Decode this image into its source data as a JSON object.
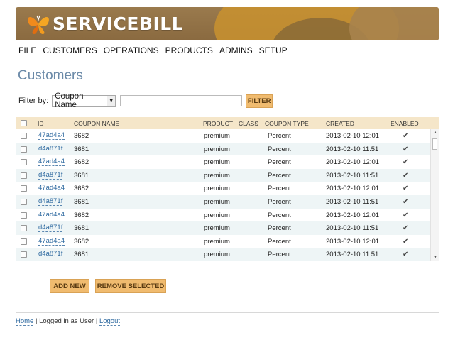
{
  "brand": {
    "name": "SERVICEBILL"
  },
  "menu": [
    "FILE",
    "CUSTOMERS",
    "OPERATIONS",
    "PRODUCTS",
    "ADMINS",
    "SETUP"
  ],
  "page": {
    "title": "Customers"
  },
  "filter": {
    "label": "Filter by:",
    "selected": "Coupon Name",
    "input_value": "",
    "button": "FILTER"
  },
  "grid": {
    "columns": [
      "ID",
      "COUPON NAME",
      "PRODUCT",
      "CLASS",
      "COUPON TYPE",
      "CREATED",
      "ENABLED"
    ],
    "rows": [
      {
        "id": "47ad4a4",
        "coupon_name": "3682",
        "product": "premium",
        "class": "",
        "coupon_type": "Percent",
        "created": "2013-02-10 12:01",
        "enabled": "✔"
      },
      {
        "id": "d4a871f",
        "coupon_name": "3681",
        "product": "premium",
        "class": "",
        "coupon_type": "Percent",
        "created": "2013-02-10 11:51",
        "enabled": "✔"
      },
      {
        "id": "47ad4a4",
        "coupon_name": "3682",
        "product": "premium",
        "class": "",
        "coupon_type": "Percent",
        "created": "2013-02-10 12:01",
        "enabled": "✔"
      },
      {
        "id": "d4a871f",
        "coupon_name": "3681",
        "product": "premium",
        "class": "",
        "coupon_type": "Percent",
        "created": "2013-02-10 11:51",
        "enabled": "✔"
      },
      {
        "id": "47ad4a4",
        "coupon_name": "3682",
        "product": "premium",
        "class": "",
        "coupon_type": "Percent",
        "created": "2013-02-10 12:01",
        "enabled": "✔"
      },
      {
        "id": "d4a871f",
        "coupon_name": "3681",
        "product": "premium",
        "class": "",
        "coupon_type": "Percent",
        "created": "2013-02-10 11:51",
        "enabled": "✔"
      },
      {
        "id": "47ad4a4",
        "coupon_name": "3682",
        "product": "premium",
        "class": "",
        "coupon_type": "Percent",
        "created": "2013-02-10 12:01",
        "enabled": "✔"
      },
      {
        "id": "d4a871f",
        "coupon_name": "3681",
        "product": "premium",
        "class": "",
        "coupon_type": "Percent",
        "created": "2013-02-10 11:51",
        "enabled": "✔"
      },
      {
        "id": "47ad4a4",
        "coupon_name": "3682",
        "product": "premium",
        "class": "",
        "coupon_type": "Percent",
        "created": "2013-02-10 12:01",
        "enabled": "✔"
      },
      {
        "id": "d4a871f",
        "coupon_name": "3681",
        "product": "premium",
        "class": "",
        "coupon_type": "Percent",
        "created": "2013-02-10 11:51",
        "enabled": "✔"
      }
    ]
  },
  "actions": {
    "add": "ADD NEW",
    "remove": "REMOVE SELECTED"
  },
  "footer": {
    "home": "Home",
    "separator": "|",
    "logged_in": "Logged in as User",
    "logout": "Logout"
  },
  "colors": {
    "accent_button": "#f0bb6f",
    "header_row": "#f5e6c9",
    "alt_row": "#eef5f6",
    "title": "#6b8aa8",
    "link": "#2f6aa0"
  }
}
